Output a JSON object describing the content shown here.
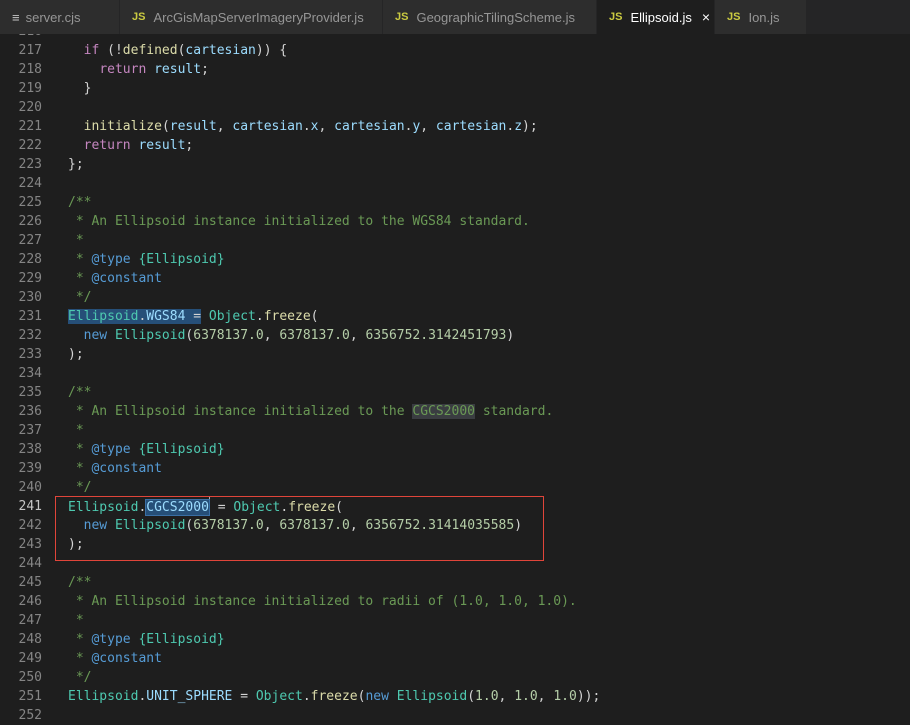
{
  "tabs": [
    {
      "icon": "lines",
      "icon_text": "≡",
      "label": "server.cjs"
    },
    {
      "icon": "js",
      "icon_text": "JS",
      "label": "ArcGisMapServerImageryProvider.js"
    },
    {
      "icon": "js",
      "icon_text": "JS",
      "label": "GeographicTilingScheme.js"
    },
    {
      "icon": "js",
      "icon_text": "JS",
      "label": "Ellipsoid.js",
      "active": true,
      "close": "×"
    },
    {
      "icon": "js",
      "icon_text": "JS",
      "label": "Ion.js"
    }
  ],
  "current_line": 241,
  "lines": [
    {
      "n": "216",
      "tokens": []
    },
    {
      "n": "217",
      "tokens": [
        [
          "p",
          "  "
        ],
        [
          "kw",
          "if"
        ],
        [
          "p",
          " (!"
        ],
        [
          "fn",
          "defined"
        ],
        [
          "p",
          "("
        ],
        [
          "var",
          "cartesian"
        ],
        [
          "p",
          ")) {"
        ]
      ]
    },
    {
      "n": "218",
      "tokens": [
        [
          "p",
          "    "
        ],
        [
          "kw",
          "return"
        ],
        [
          "p",
          " "
        ],
        [
          "var",
          "result"
        ],
        [
          "p",
          ";"
        ]
      ]
    },
    {
      "n": "219",
      "tokens": [
        [
          "p",
          "  }"
        ]
      ]
    },
    {
      "n": "220",
      "tokens": []
    },
    {
      "n": "221",
      "tokens": [
        [
          "p",
          "  "
        ],
        [
          "fn",
          "initialize"
        ],
        [
          "p",
          "("
        ],
        [
          "var",
          "result"
        ],
        [
          "p",
          ", "
        ],
        [
          "var",
          "cartesian"
        ],
        [
          "p",
          "."
        ],
        [
          "var",
          "x"
        ],
        [
          "p",
          ", "
        ],
        [
          "var",
          "cartesian"
        ],
        [
          "p",
          "."
        ],
        [
          "var",
          "y"
        ],
        [
          "p",
          ", "
        ],
        [
          "var",
          "cartesian"
        ],
        [
          "p",
          "."
        ],
        [
          "var",
          "z"
        ],
        [
          "p",
          ");"
        ]
      ]
    },
    {
      "n": "222",
      "tokens": [
        [
          "p",
          "  "
        ],
        [
          "kw",
          "return"
        ],
        [
          "p",
          " "
        ],
        [
          "var",
          "result"
        ],
        [
          "p",
          ";"
        ]
      ]
    },
    {
      "n": "223",
      "tokens": [
        [
          "p",
          "};"
        ]
      ]
    },
    {
      "n": "224",
      "tokens": []
    },
    {
      "n": "225",
      "tokens": [
        [
          "cmt",
          "/**"
        ]
      ]
    },
    {
      "n": "226",
      "tokens": [
        [
          "cmt",
          " * An Ellipsoid instance initialized to the WGS84 standard."
        ]
      ]
    },
    {
      "n": "227",
      "tokens": [
        [
          "cmt",
          " *"
        ]
      ]
    },
    {
      "n": "228",
      "tokens": [
        [
          "cmt",
          " * "
        ],
        [
          "tag",
          "@type"
        ],
        [
          "cmt",
          " "
        ],
        [
          "cls",
          "{Ellipsoid}"
        ]
      ]
    },
    {
      "n": "229",
      "tokens": [
        [
          "cmt",
          " * "
        ],
        [
          "tag",
          "@constant"
        ]
      ]
    },
    {
      "n": "230",
      "tokens": [
        [
          "cmt",
          " */"
        ]
      ]
    },
    {
      "n": "231",
      "tokens": [
        [
          "cls hl",
          "Ellipsoid"
        ],
        [
          "hlp",
          "."
        ],
        [
          "var hl",
          "WGS84"
        ],
        [
          "hlp",
          " ="
        ],
        [
          "p",
          " "
        ],
        [
          "cls",
          "Object"
        ],
        [
          "p",
          "."
        ],
        [
          "fn",
          "freeze"
        ],
        [
          "p",
          "("
        ]
      ]
    },
    {
      "n": "232",
      "tokens": [
        [
          "p",
          "  "
        ],
        [
          "sk",
          "new"
        ],
        [
          "p",
          " "
        ],
        [
          "cls",
          "Ellipsoid"
        ],
        [
          "p",
          "("
        ],
        [
          "num",
          "6378137.0"
        ],
        [
          "p",
          ", "
        ],
        [
          "num",
          "6378137.0"
        ],
        [
          "p",
          ", "
        ],
        [
          "num",
          "6356752.3142451793"
        ],
        [
          "p",
          ")"
        ]
      ]
    },
    {
      "n": "233",
      "tokens": [
        [
          "p",
          ");"
        ]
      ]
    },
    {
      "n": "234",
      "tokens": []
    },
    {
      "n": "235",
      "tokens": [
        [
          "cmt",
          "/**"
        ]
      ]
    },
    {
      "n": "236",
      "tokens": [
        [
          "cmt",
          " * An Ellipsoid instance initialized to the "
        ],
        [
          "cmt wh",
          "CGCS2000"
        ],
        [
          "cmt",
          " standard."
        ]
      ]
    },
    {
      "n": "237",
      "tokens": [
        [
          "cmt",
          " *"
        ]
      ]
    },
    {
      "n": "238",
      "tokens": [
        [
          "cmt",
          " * "
        ],
        [
          "tag",
          "@type"
        ],
        [
          "cmt",
          " "
        ],
        [
          "cls",
          "{Ellipsoid}"
        ]
      ]
    },
    {
      "n": "239",
      "tokens": [
        [
          "cmt",
          " * "
        ],
        [
          "tag",
          "@constant"
        ]
      ]
    },
    {
      "n": "240",
      "tokens": [
        [
          "cmt",
          " */"
        ]
      ]
    },
    {
      "n": "241",
      "tokens": [
        [
          "cls",
          "Ellipsoid"
        ],
        [
          "p",
          "."
        ],
        [
          "var sel",
          "CGCS2000"
        ],
        [
          "cursor",
          ""
        ],
        [
          "p",
          " = "
        ],
        [
          "cls",
          "Object"
        ],
        [
          "p",
          "."
        ],
        [
          "fn",
          "freeze"
        ],
        [
          "p",
          "("
        ]
      ]
    },
    {
      "n": "242",
      "tokens": [
        [
          "p",
          "  "
        ],
        [
          "sk",
          "new"
        ],
        [
          "p",
          " "
        ],
        [
          "cls",
          "Ellipsoid"
        ],
        [
          "p",
          "("
        ],
        [
          "num",
          "6378137.0"
        ],
        [
          "p",
          ", "
        ],
        [
          "num",
          "6378137.0"
        ],
        [
          "p",
          ", "
        ],
        [
          "num",
          "6356752.31414035585"
        ],
        [
          "p",
          ")"
        ]
      ]
    },
    {
      "n": "243",
      "tokens": [
        [
          "p",
          ");"
        ]
      ]
    },
    {
      "n": "244",
      "tokens": []
    },
    {
      "n": "245",
      "tokens": [
        [
          "cmt",
          "/**"
        ]
      ]
    },
    {
      "n": "246",
      "tokens": [
        [
          "cmt",
          " * An Ellipsoid instance initialized to radii of (1.0, 1.0, 1.0)."
        ]
      ]
    },
    {
      "n": "247",
      "tokens": [
        [
          "cmt",
          " *"
        ]
      ]
    },
    {
      "n": "248",
      "tokens": [
        [
          "cmt",
          " * "
        ],
        [
          "tag",
          "@type"
        ],
        [
          "cmt",
          " "
        ],
        [
          "cls",
          "{Ellipsoid}"
        ]
      ]
    },
    {
      "n": "249",
      "tokens": [
        [
          "cmt",
          " * "
        ],
        [
          "tag",
          "@constant"
        ]
      ]
    },
    {
      "n": "250",
      "tokens": [
        [
          "cmt",
          " */"
        ]
      ]
    },
    {
      "n": "251",
      "tokens": [
        [
          "cls",
          "Ellipsoid"
        ],
        [
          "p",
          "."
        ],
        [
          "var",
          "UNIT_SPHERE"
        ],
        [
          "p",
          " = "
        ],
        [
          "cls",
          "Object"
        ],
        [
          "p",
          "."
        ],
        [
          "fn",
          "freeze"
        ],
        [
          "p",
          "("
        ],
        [
          "sk",
          "new"
        ],
        [
          "p",
          " "
        ],
        [
          "cls",
          "Ellipsoid"
        ],
        [
          "p",
          "("
        ],
        [
          "num",
          "1.0"
        ],
        [
          "p",
          ", "
        ],
        [
          "num",
          "1.0"
        ],
        [
          "p",
          ", "
        ],
        [
          "num",
          "1.0"
        ],
        [
          "p",
          "));"
        ]
      ]
    },
    {
      "n": "252",
      "tokens": []
    }
  ]
}
